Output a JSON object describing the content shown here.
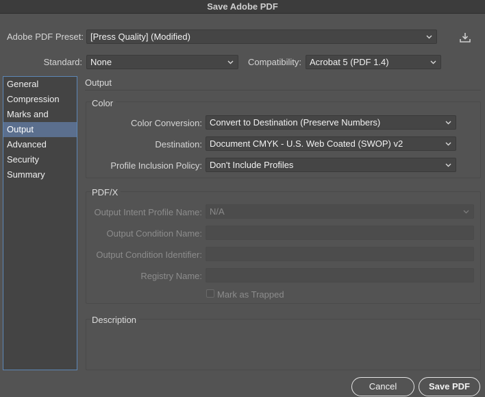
{
  "window": {
    "title": "Save Adobe PDF"
  },
  "preset": {
    "label": "Adobe PDF Preset:",
    "value": "[Press Quality] (Modified)"
  },
  "standard": {
    "label": "Standard:",
    "value": "None"
  },
  "compatibility": {
    "label": "Compatibility:",
    "value": "Acrobat 5 (PDF 1.4)"
  },
  "sidebar": {
    "items": [
      {
        "label": "General"
      },
      {
        "label": "Compression"
      },
      {
        "label": "Marks and Bleeds"
      },
      {
        "label": "Output"
      },
      {
        "label": "Advanced"
      },
      {
        "label": "Security"
      },
      {
        "label": "Summary"
      }
    ],
    "selected": "Output"
  },
  "main": {
    "heading": "Output",
    "color": {
      "title": "Color",
      "conversion": {
        "label": "Color Conversion:",
        "value": "Convert to Destination (Preserve Numbers)"
      },
      "destination": {
        "label": "Destination:",
        "value": "Document CMYK - U.S. Web Coated (SWOP) v2"
      },
      "profile_policy": {
        "label": "Profile Inclusion Policy:",
        "value": "Don't Include Profiles"
      }
    },
    "pdfx": {
      "title": "PDF/X",
      "intent_profile": {
        "label": "Output Intent Profile Name:",
        "value": "N/A"
      },
      "condition_name": {
        "label": "Output Condition Name:",
        "value": ""
      },
      "condition_identifier": {
        "label": "Output Condition Identifier:",
        "value": ""
      },
      "registry_name": {
        "label": "Registry Name:",
        "value": ""
      },
      "mark_trapped": {
        "label": "Mark as Trapped",
        "checked": false
      }
    },
    "description": {
      "title": "Description",
      "text": ""
    }
  },
  "buttons": {
    "cancel": "Cancel",
    "save": "Save PDF"
  },
  "icons": {
    "save_preset": "download-tray-icon",
    "dropdown": "chevron-down-icon"
  },
  "colors": {
    "accent": "#5b6f8e",
    "sidebar_border": "#5d88b8",
    "background": "#535353"
  }
}
